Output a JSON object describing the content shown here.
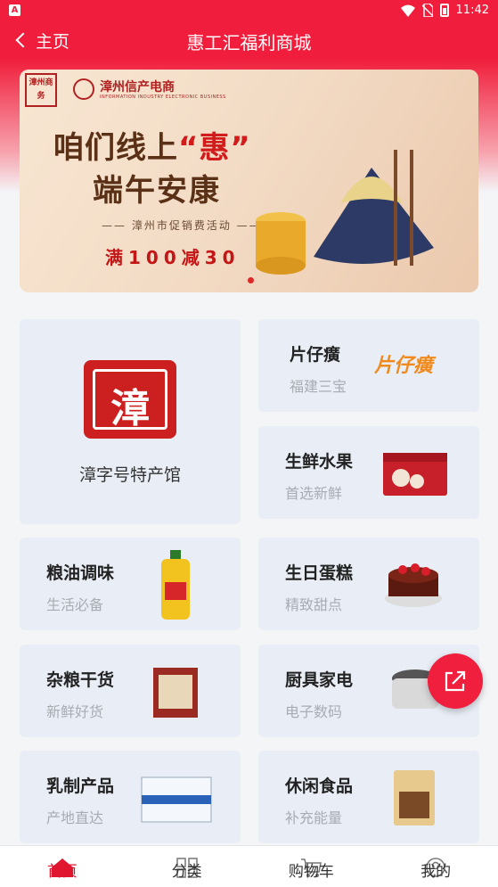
{
  "status_bar": {
    "time": "11:42",
    "left_icon": "A"
  },
  "nav": {
    "back_label": "主页",
    "title": "惠工汇福利商城"
  },
  "banner": {
    "stamp_text": "漳州商务",
    "brand": "漳州信产电商",
    "brand_sub": "INFORMATION INDUSTRY ELECTRONIC BUSINESS",
    "headline_pre": "咱们线上",
    "headline_highlight": "“惠”",
    "headline2": "端午安康",
    "subtitle": "—— 漳州市促销费活动 ——",
    "promo": "满100减30"
  },
  "featured": {
    "seal_char": "漳",
    "label": "漳字号特产馆"
  },
  "categories": [
    {
      "name": "片仔癀",
      "sub": "福建三宝",
      "logo": "片仔癀"
    },
    {
      "name": "生鲜水果",
      "sub": "首选新鲜"
    },
    {
      "name": "粮油调味",
      "sub": "生活必备"
    },
    {
      "name": "生日蛋糕",
      "sub": "精致甜点"
    },
    {
      "name": "杂粮干货",
      "sub": "新鲜好货"
    },
    {
      "name": "厨具家电",
      "sub": "电子数码"
    },
    {
      "name": "乳制产品",
      "sub": "产地直达"
    },
    {
      "name": "休闲食品",
      "sub": "补充能量"
    }
  ],
  "tabs": [
    {
      "label": "首页",
      "icon": "home-icon"
    },
    {
      "label": "分类",
      "icon": "category-icon"
    },
    {
      "label": "购物车",
      "icon": "cart-icon"
    },
    {
      "label": "我的",
      "icon": "user-icon"
    }
  ],
  "colors": {
    "primary": "#f01e3c",
    "tile_bg": "#e9eef6"
  }
}
